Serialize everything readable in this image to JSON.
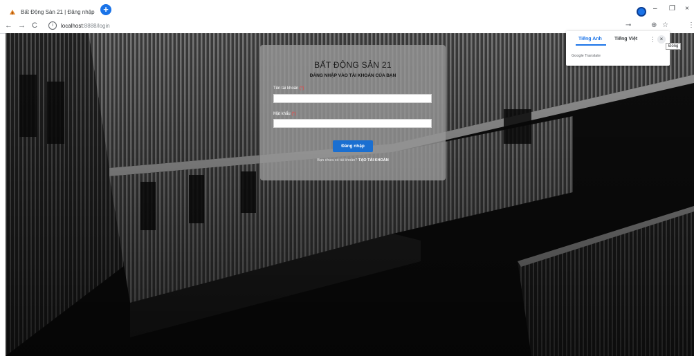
{
  "browser": {
    "tab_title": "Bất Động Sản 21 | Đăng nhập",
    "tab_close": "×",
    "new_tab": "+",
    "minimize": "–",
    "restore": "❐",
    "close": "×",
    "back": "←",
    "forward": "→",
    "reload": "C",
    "url_host": "localhost",
    "url_path": ":8888/login",
    "avatar_letter": "T"
  },
  "login": {
    "brand": "BẤT ĐỘNG SẢN 21",
    "subtitle": "ĐĂNG NHẬP VÀO TÀI KHOẢN CỦA BẠN",
    "username_label": "Tên tài khoản",
    "password_label": "Mật khẩu",
    "required_mark": "(*)",
    "username_value": "",
    "password_value": "",
    "login_button": "Đăng nhập",
    "register_prompt": "Bạn chưa có tài khoản?",
    "register_link": "TẠO TÀI KHOẢN"
  },
  "translate_popup": {
    "tab_english": "Tiếng Anh",
    "tab_vietnamese": "Tiếng Việt",
    "brand": "Google Translate",
    "close_tooltip": "Đóng"
  },
  "colors": {
    "accent": "#1a6fd1",
    "required": "#ff3b3b",
    "card_bg": "rgba(150,150,150,0.82)"
  }
}
